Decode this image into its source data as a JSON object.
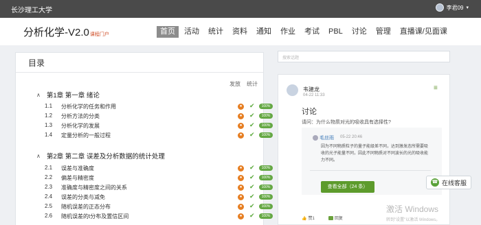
{
  "topbar": {
    "school": "长沙理工大学",
    "user": "李君09"
  },
  "header": {
    "course_title": "分析化学-V2.0",
    "course_sub": "课程门户"
  },
  "nav": [
    "首页",
    "活动",
    "统计",
    "资料",
    "通知",
    "作业",
    "考试",
    "PBL",
    "讨论",
    "管理",
    "直播课/见面课"
  ],
  "outline": {
    "title": "目录",
    "col_publish": "发放",
    "col_stats": "统计",
    "chapters": [
      {
        "label": "第1章 第一章 绪论",
        "sections": [
          {
            "num": "1.1",
            "title": "分析化学的任务和作用",
            "status": "100%"
          },
          {
            "num": "1.2",
            "title": "分析方法的分类",
            "status": "100%"
          },
          {
            "num": "1.3",
            "title": "分析化学的发展",
            "status": "100%"
          },
          {
            "num": "1.4",
            "title": "定量分析的一般过程",
            "status": "100%"
          }
        ]
      },
      {
        "label": "第2章 第二章 误差及分析数据的统计处理",
        "sections": [
          {
            "num": "2.1",
            "title": "误差与准确度",
            "status": "100%"
          },
          {
            "num": "2.2",
            "title": "偏差与精密度",
            "status": "100%"
          },
          {
            "num": "2.3",
            "title": "准确度与精密度之间的关系",
            "status": "100%"
          },
          {
            "num": "2.4",
            "title": "误差的分类与减免",
            "status": "100%"
          },
          {
            "num": "2.5",
            "title": "随机误差的正态分布",
            "status": "100%"
          },
          {
            "num": "2.6",
            "title": "随机误差的t分布及置信区间",
            "status": "100%"
          }
        ]
      }
    ]
  },
  "search": {
    "placeholder": "搜索话题"
  },
  "discussion": {
    "author": "韦建龙",
    "time": "04-22 11:33",
    "topic": "讨论",
    "question": "请问：为什么物质对光的吸收具有选择性?",
    "reply": {
      "author": "毛丝雨",
      "time": "05-22 20:46",
      "body": "因为不同物质粒子的量子能级差不同，达到激发态所需要吸收的光子能量不同，因此不同物质对不同波长的光的吸收能力不同。"
    },
    "view_all": "查看全部（24 条）",
    "like_label": "赞1",
    "reply_label": "回复"
  },
  "service_label": "在线客服",
  "watermark": {
    "line1": "激活 Windows",
    "line2": "转到\"设置\"以激活 Windows。"
  },
  "colors": {
    "topbar": "#4a4a4a",
    "accent_green": "#5d9b2c",
    "badge_orange": "#e67e22",
    "nav_active": "#8c8c8c"
  }
}
